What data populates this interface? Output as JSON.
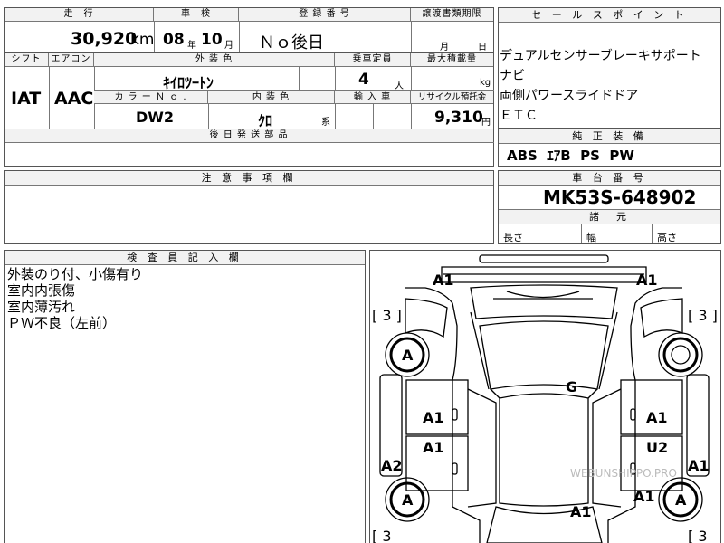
{
  "summary": {
    "mileage_label": "走　行",
    "mileage_value": "30,920",
    "mileage_unit": "km",
    "inspection_label": "車　検",
    "inspection_year": "08",
    "inspection_year_unit": "年",
    "inspection_month": "10",
    "inspection_month_unit": "月",
    "registration_label": "登 録 番 号",
    "registration_value": "Ｎｏ後日",
    "transfer_label": "譲渡書類期限",
    "transfer_month_unit": "月",
    "transfer_day_unit": "日"
  },
  "specs": {
    "shift_label": "シフト",
    "shift_value": "IAT",
    "aircon_label": "エアコン",
    "aircon_value": "AAC",
    "exterior_label": "外 装 色",
    "exterior_value": "ｷｲﾛﾂｰﾄﾝ",
    "capacity_label": "乗車定員",
    "capacity_value": "4",
    "capacity_unit": "人",
    "load_label": "最大積載量",
    "load_unit": "kg",
    "color_no_label": "カ ラ ー Ｎ ｏ .",
    "color_no_value": "DW2",
    "interior_label": "内 装 色",
    "interior_value": "ｸﾛ",
    "interior_suffix": "系",
    "import_label": "輸 入 車",
    "recycle_label": "リサイクル預託金",
    "recycle_value": "9,310",
    "recycle_unit": "円",
    "later_parts_label": "後 日 発 送 部 品"
  },
  "sales_points": {
    "title": "セ ー ル ス ポ イ ン ト",
    "lines": [
      "デュアルセンサーブレーキサポート",
      "ナビ",
      "両側パワースライドドア",
      "ＥＴＣ"
    ]
  },
  "genuine_equipment": {
    "title": "純 正 装 備",
    "value": "ABS  ｴｱB  PS  PW"
  },
  "notes": {
    "title": "注 意 事 項 欄"
  },
  "chassis": {
    "title": "車 台 番 号",
    "value": "MK53S-648902",
    "dimensions_title": "諸　元",
    "length_label": "長さ",
    "width_label": "幅",
    "height_label": "高さ"
  },
  "inspector": {
    "title": "検 査 員 記 入 欄",
    "lines": [
      "外装のり付、小傷有り",
      "室内内張傷",
      "室内薄汚れ",
      "ＰＷ不良（左前）"
    ]
  },
  "damage_marks": {
    "front_left": "A1",
    "front_right": "A1",
    "left_tire_front": "A",
    "right_tire_front": "",
    "left_tire_rear": "A",
    "right_tire_rear": "A",
    "bracket_tl": "[ 3 ]",
    "bracket_tr": "[ 3 ]",
    "bracket_bl": "[ 3",
    "bracket_br": "[ 3",
    "windshield": "G",
    "left_front_door": "A1",
    "right_front_door": "A1",
    "left_rear_door": "A1",
    "right_rear_door": "U2",
    "left_sill": "A2",
    "right_sill": "A1",
    "right_rear_quarter": "A1",
    "roof_rear": "A1"
  },
  "watermark": "WEBUNSHIPPO.PRO"
}
